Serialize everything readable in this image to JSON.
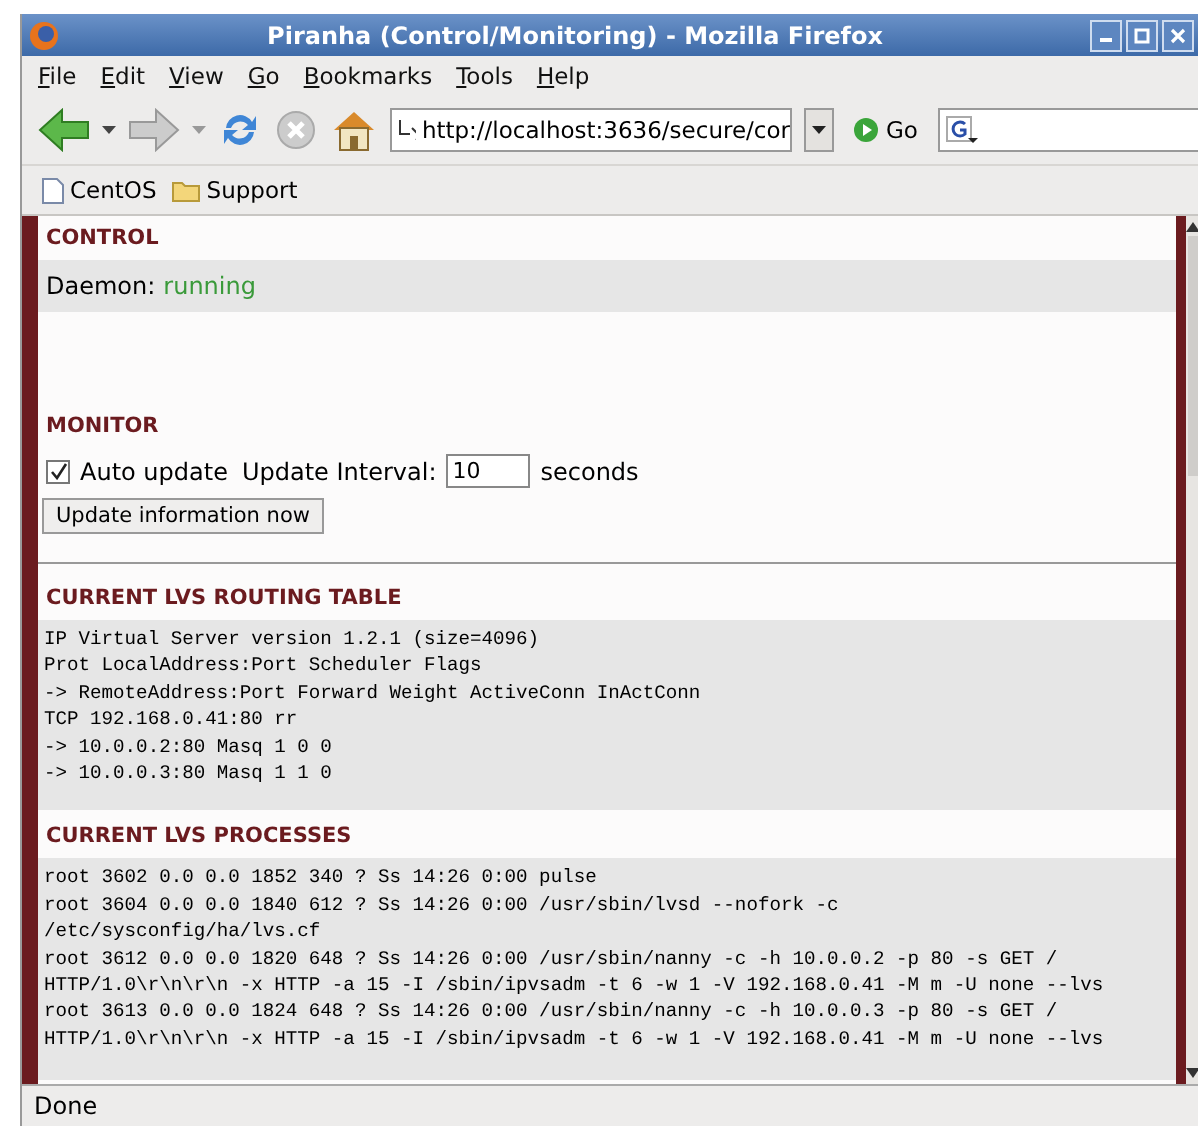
{
  "window": {
    "title": "Piranha (Control/Monitoring) - Mozilla Firefox"
  },
  "menu": [
    "File",
    "Edit",
    "View",
    "Go",
    "Bookmarks",
    "Tools",
    "Help"
  ],
  "toolbar": {
    "url": "http://localhost:3636/secure/cor",
    "go": "Go"
  },
  "bookmarks": [
    {
      "label": "CentOS",
      "kind": "page"
    },
    {
      "label": "Support",
      "kind": "folder"
    }
  ],
  "control": {
    "heading": "CONTROL",
    "daemon_label": "Daemon:",
    "daemon_status": "running"
  },
  "monitor": {
    "heading": "MONITOR",
    "auto_update": {
      "label": "Auto update",
      "checked": true
    },
    "interval_label": "Update Interval:",
    "interval_value": "10",
    "unit": "seconds",
    "button": "Update information now"
  },
  "routing": {
    "heading": "CURRENT LVS ROUTING TABLE",
    "lines": [
      "IP Virtual Server version 1.2.1 (size=4096)",
      "Prot LocalAddress:Port Scheduler Flags",
      "-> RemoteAddress:Port Forward Weight ActiveConn InActConn",
      "TCP 192.168.0.41:80 rr",
      "-> 10.0.0.2:80 Masq 1 0 0",
      "-> 10.0.0.3:80 Masq 1 1 0"
    ]
  },
  "processes": {
    "heading": "CURRENT LVS PROCESSES",
    "lines": [
      "root 3602 0.0 0.0 1852 340 ? Ss 14:26 0:00 pulse",
      "root 3604 0.0 0.0 1840 612 ? Ss 14:26 0:00 /usr/sbin/lvsd --nofork -c",
      "/etc/sysconfig/ha/lvs.cf",
      "root 3612 0.0 0.0 1820 648 ? Ss 14:26 0:00 /usr/sbin/nanny -c -h 10.0.0.2 -p 80 -s GET /",
      "HTTP/1.0\\r\\n\\r\\n -x HTTP -a 15 -I /sbin/ipvsadm -t 6 -w 1 -V 192.168.0.41 -M m -U none --lvs",
      "root 3613 0.0 0.0 1824 648 ? Ss 14:26 0:00 /usr/sbin/nanny -c -h 10.0.0.3 -p 80 -s GET /",
      "HTTP/1.0\\r\\n\\r\\n -x HTTP -a 15 -I /sbin/ipvsadm -t 6 -w 1 -V 192.168.0.41 -M m -U none --lvs"
    ]
  },
  "status_bar": "Done"
}
